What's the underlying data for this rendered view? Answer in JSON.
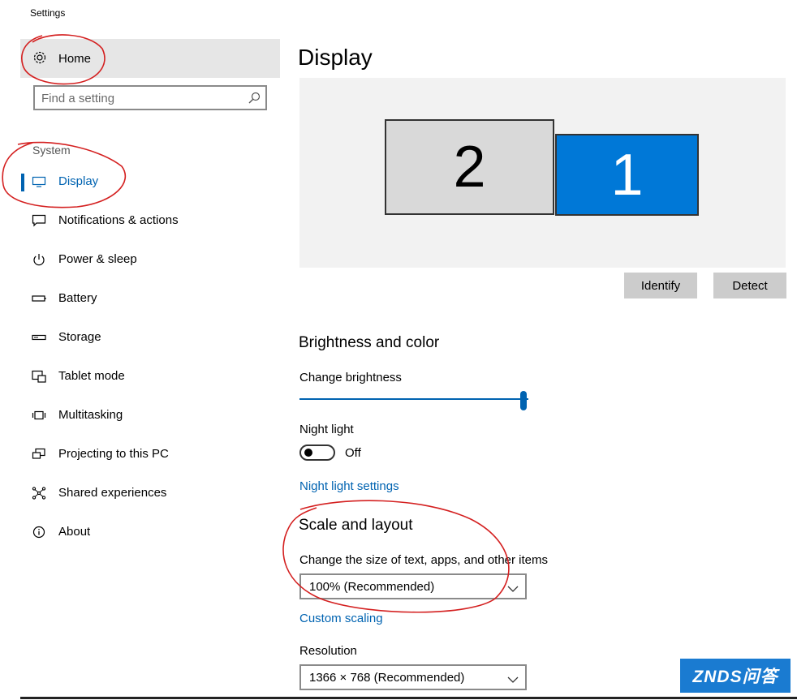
{
  "window": {
    "title": "Settings"
  },
  "sidebar": {
    "home_label": "Home",
    "search_placeholder": "Find a setting",
    "section_label": "System",
    "items": [
      {
        "label": "Display",
        "icon": "monitor-icon",
        "active": true
      },
      {
        "label": "Notifications & actions",
        "icon": "speech-bubble-icon"
      },
      {
        "label": "Power & sleep",
        "icon": "power-icon"
      },
      {
        "label": "Battery",
        "icon": "battery-icon"
      },
      {
        "label": "Storage",
        "icon": "storage-drive-icon"
      },
      {
        "label": "Tablet mode",
        "icon": "tablet-mode-icon"
      },
      {
        "label": "Multitasking",
        "icon": "multitasking-icon"
      },
      {
        "label": "Projecting to this PC",
        "icon": "projecting-icon"
      },
      {
        "label": "Shared experiences",
        "icon": "shared-experiences-icon"
      },
      {
        "label": "About",
        "icon": "info-icon"
      }
    ]
  },
  "main": {
    "title": "Display",
    "monitors": [
      {
        "number": "2"
      },
      {
        "number": "1",
        "selected": true
      }
    ],
    "identify_label": "Identify",
    "detect_label": "Detect",
    "brightness": {
      "heading": "Brightness and color",
      "change_brightness_label": "Change brightness",
      "brightness_level": 1.0,
      "night_light_label": "Night light",
      "night_light_state": "Off",
      "night_light_settings_link": "Night light settings"
    },
    "scale": {
      "heading": "Scale and layout",
      "size_label": "Change the size of text, apps, and other items",
      "size_value": "100% (Recommended)",
      "custom_scaling_link": "Custom scaling",
      "resolution_label": "Resolution",
      "resolution_value": "1366 × 768 (Recommended)"
    }
  },
  "watermark": {
    "text": "ZNDS问答"
  },
  "colors": {
    "accent": "#0063b1",
    "selected_monitor": "#0078d7",
    "annotation": "#d42020"
  }
}
